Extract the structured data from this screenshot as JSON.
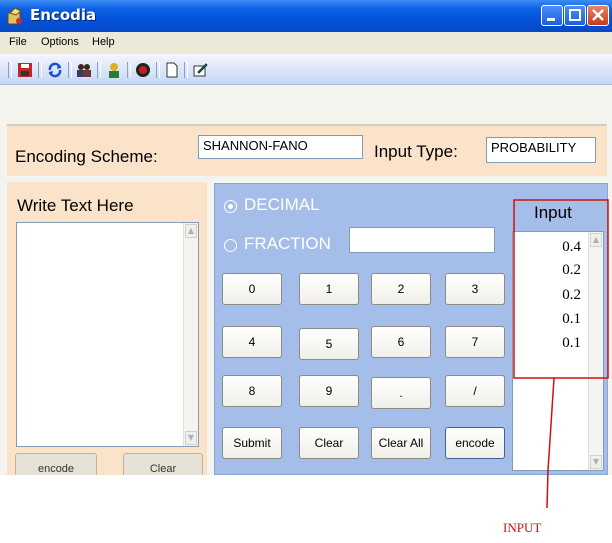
{
  "window": {
    "title": "Encodia",
    "icon": "app-icon"
  },
  "menu": [
    "File",
    "Options",
    "Help"
  ],
  "toolbar": {
    "icons": [
      "save-icon",
      "refresh-icon",
      "users-icon",
      "user-icon",
      "stop-icon",
      "new-document-icon",
      "edit-icon"
    ]
  },
  "encoding": {
    "scheme_label": "Encoding Scheme:",
    "scheme_value": "SHANNON-FANO",
    "input_type_label": "Input Type:",
    "input_type_value": "PROBABILITY"
  },
  "text_panel": {
    "heading": "Write Text Here",
    "encode_label": "encode",
    "clear_label": "Clear"
  },
  "calculator": {
    "decimal_label": "DECIMAL",
    "fraction_label": "FRACTION",
    "selected_mode": "DECIMAL",
    "fraction_value": "",
    "keys": [
      "0",
      "1",
      "2",
      "3",
      "4",
      "5",
      "6",
      "7",
      "8",
      "9",
      ".",
      "/"
    ],
    "submit_label": "Submit",
    "clear_label": "Clear",
    "clear_all_label": "Clear All",
    "encode_label": "encode"
  },
  "input_list": {
    "heading": "Input",
    "values": [
      "0.4",
      "0.2",
      "0.2",
      "0.1",
      "0.1"
    ]
  },
  "annotation": {
    "text": "INPUT",
    "color": "#cc1111"
  },
  "colors": {
    "titlebar": "#0450d8",
    "panel_peach": "#fbe3c9",
    "panel_blue": "#a4bde9",
    "annotation_red": "#cc1111"
  }
}
